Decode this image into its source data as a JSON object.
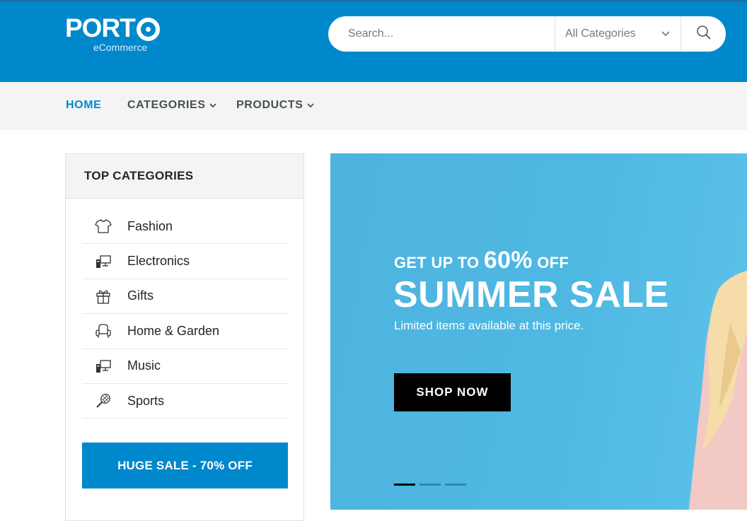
{
  "header": {
    "logo_text": "PORT",
    "logo_sub": "eCommerce",
    "search_placeholder": "Search...",
    "category_select": "All Categories"
  },
  "nav": {
    "items": [
      {
        "label": "HOME",
        "active": true
      },
      {
        "label": "CATEGORIES"
      },
      {
        "label": "PRODUCTS"
      }
    ]
  },
  "sidebar": {
    "title": "TOP CATEGORIES",
    "categories": [
      {
        "label": "Fashion",
        "icon": "tshirt-icon"
      },
      {
        "label": "Electronics",
        "icon": "computer-icon"
      },
      {
        "label": "Gifts",
        "icon": "gift-icon"
      },
      {
        "label": "Home & Garden",
        "icon": "armchair-icon"
      },
      {
        "label": "Music",
        "icon": "computer-icon"
      },
      {
        "label": "Sports",
        "icon": "tennis-racket-icon"
      }
    ],
    "sale_button": "HUGE SALE - 70% OFF"
  },
  "banner": {
    "line1_prefix": "GET UP TO ",
    "line1_percent": "60%",
    "line1_suffix": " OFF",
    "title": "SUMMER SALE",
    "description": "Limited items available at this price.",
    "button": "SHOP NOW",
    "slides": 3,
    "active_slide": 1
  },
  "colors": {
    "brand": "#0088cc",
    "banner_bg": "#4fb8e2",
    "dark_text": "#222529"
  }
}
